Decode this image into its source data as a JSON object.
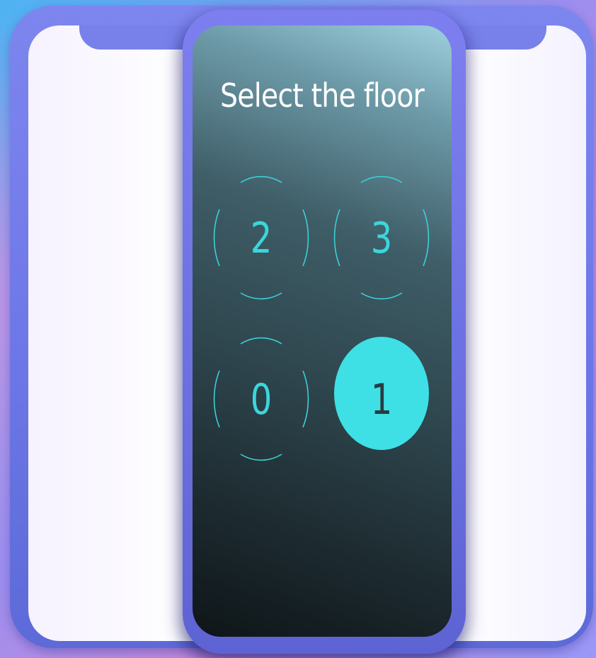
{
  "screen": {
    "title": "Select the floor"
  },
  "floors": [
    {
      "label": "2",
      "selected": false
    },
    {
      "label": "3",
      "selected": false
    },
    {
      "label": "0",
      "selected": false
    },
    {
      "label": "1",
      "selected": true
    }
  ],
  "colors": {
    "accent": "#3ee0e5",
    "title_text": "#ffffff",
    "frame": "#6f78e8"
  }
}
